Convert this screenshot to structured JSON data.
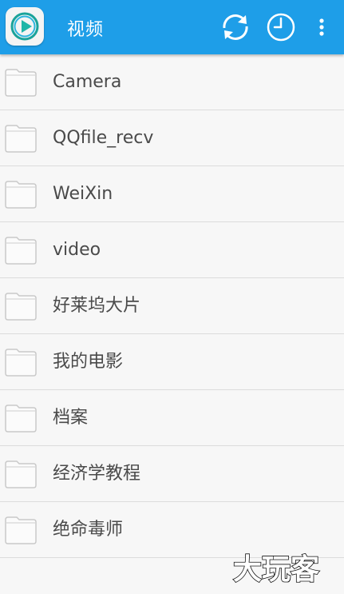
{
  "header": {
    "title": "视频",
    "background_color": "#1e9ee8",
    "actions": [
      {
        "name": "refresh-icon"
      },
      {
        "name": "clock-icon"
      },
      {
        "name": "more-vert-icon"
      }
    ]
  },
  "folders": [
    {
      "label": "Camera",
      "icon": "folder-icon"
    },
    {
      "label": "QQfile_recv",
      "icon": "folder-icon"
    },
    {
      "label": "WeiXin",
      "icon": "folder-icon"
    },
    {
      "label": "video",
      "icon": "folder-icon"
    },
    {
      "label": "好莱坞大片",
      "icon": "folder-icon"
    },
    {
      "label": "我的电影",
      "icon": "folder-icon"
    },
    {
      "label": "档案",
      "icon": "folder-icon"
    },
    {
      "label": "经济学教程",
      "icon": "folder-icon"
    },
    {
      "label": "绝命毒师",
      "icon": "folder-icon"
    }
  ],
  "watermark": {
    "text": "大玩客"
  }
}
